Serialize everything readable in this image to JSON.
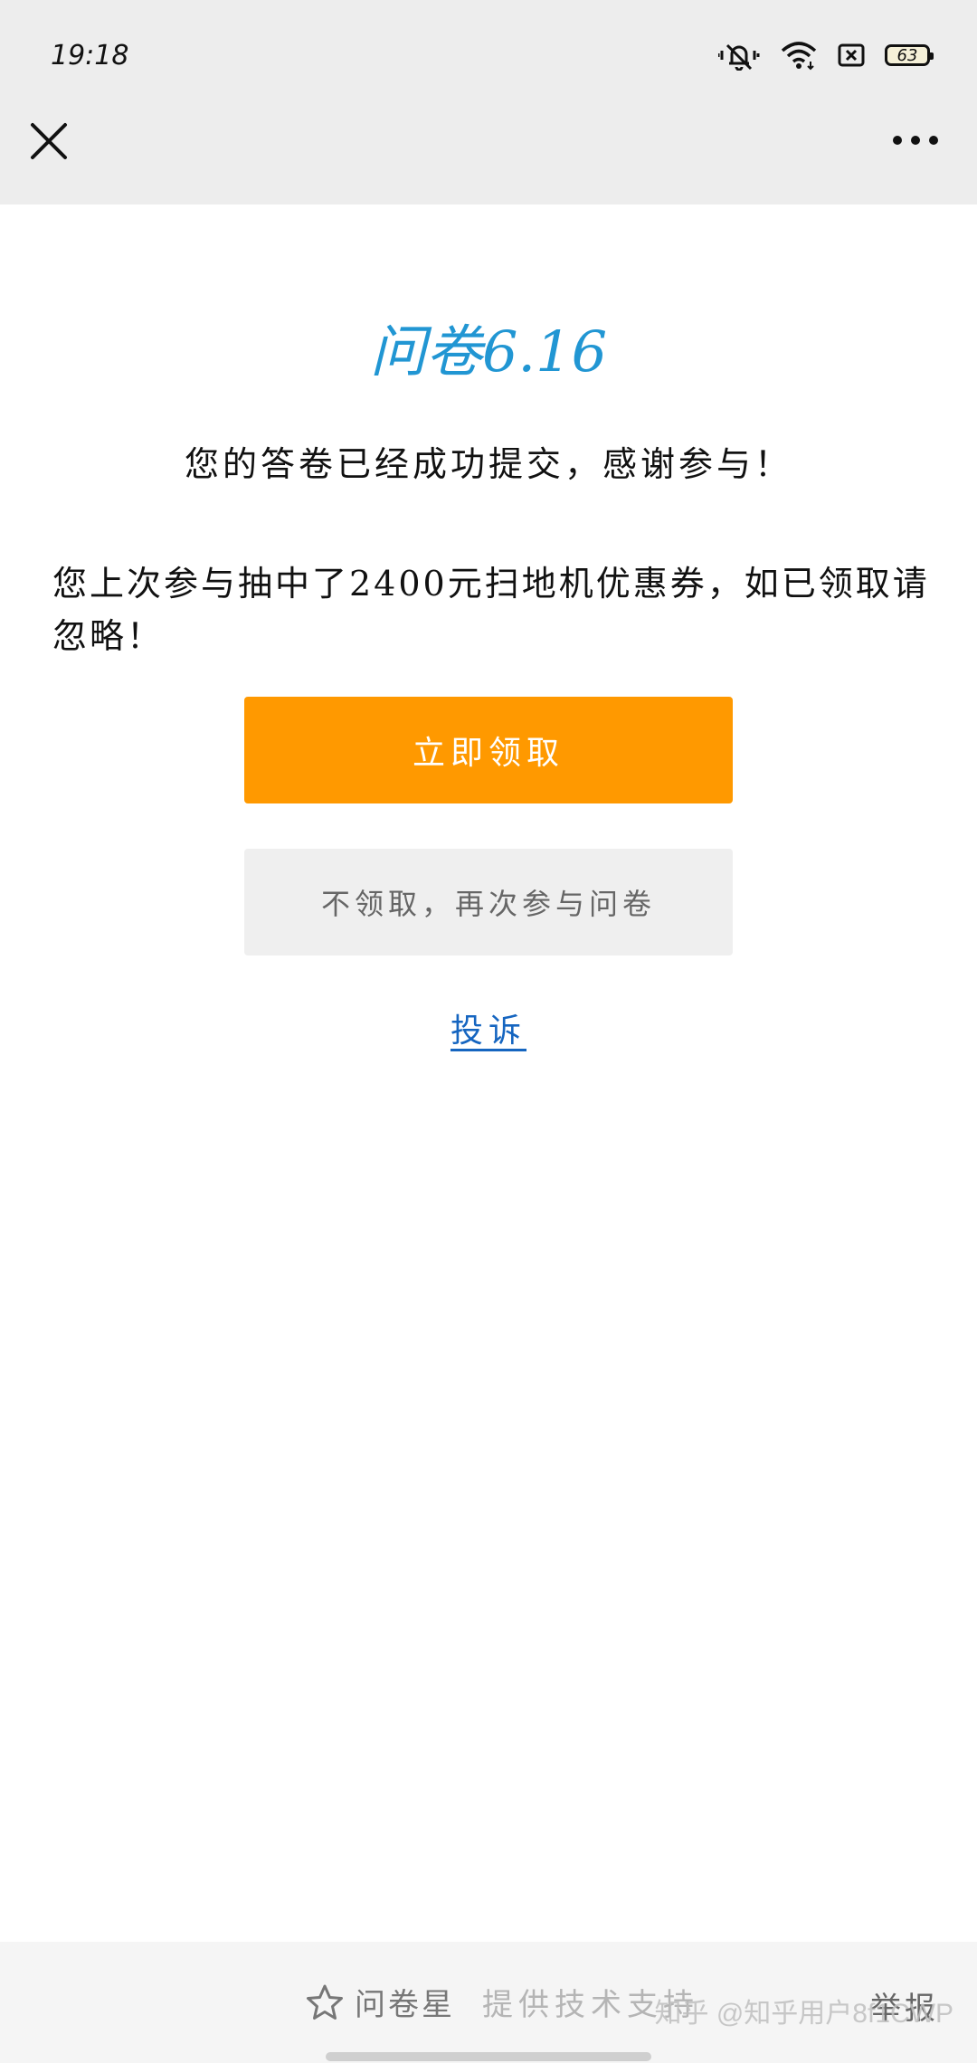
{
  "status_bar": {
    "time": "19:18",
    "battery": "63",
    "icons": [
      "mute-vibrate-icon",
      "wifi-icon",
      "sim-off-icon",
      "battery-icon"
    ]
  },
  "nav": {
    "close_icon": "close-icon",
    "more_icon": "more-icon"
  },
  "content": {
    "title": "问卷6.16",
    "thanks": "您的答卷已经成功提交，感谢参与！",
    "notice": "您上次参与抽中了2400元扫地机优惠券，如已领取请忽略！",
    "primary_button": "立即领取",
    "secondary_button": "不领取，再次参与问卷",
    "complain_link": "投诉"
  },
  "footer": {
    "brand_icon": "star-icon",
    "brand_name": "问卷星",
    "support": "提供技术支持",
    "report": "举报",
    "watermark": "知乎 @知乎用户8f1CWP"
  },
  "colors": {
    "accent_blue": "#2196d3",
    "primary_orange": "#ff9900",
    "link_blue": "#1565c0",
    "topbar_gray": "#ededed"
  }
}
